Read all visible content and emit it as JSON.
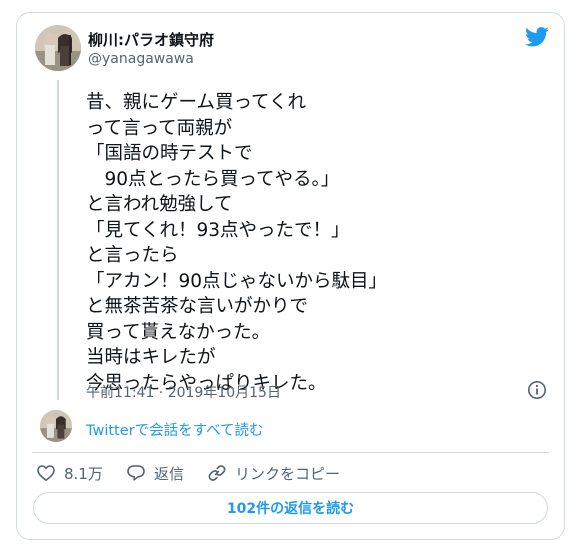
{
  "author": {
    "display_name": "柳川:パラオ鎮守府",
    "handle": "@yanagawawa"
  },
  "tweet": {
    "text": "昔、親にゲーム買ってくれ\nって言って両親が\n「国語の時テストで\n　90点とったら買ってやる。」\nと言われ勉強して\n「見てくれ！93点やったで！」\nと言ったら\n「アカン！90点じゃないから駄目」\nと無茶苦茶な言いがかりで\n買って貰えなかった。\n当時はキレたが\n今思ったらやっぱりキレた。",
    "timestamp": "午前11:41 · 2019年10月15日"
  },
  "thread": {
    "read_all_label": "Twitterで会話をすべて読む"
  },
  "actions": {
    "like_count": "8.1万",
    "reply_label": "返信",
    "copy_link_label": "リンクをコピー"
  },
  "replies_button": {
    "label": "102件の返信を読む"
  },
  "icons": {
    "brand": "twitter-bird-icon",
    "info": "info-icon",
    "like": "heart-icon",
    "reply": "speech-bubble-icon",
    "copy_link": "link-icon"
  },
  "colors": {
    "accent": "#1d9bf0",
    "text": "#0f1419",
    "secondary": "#536471",
    "border": "#cfd9de"
  }
}
